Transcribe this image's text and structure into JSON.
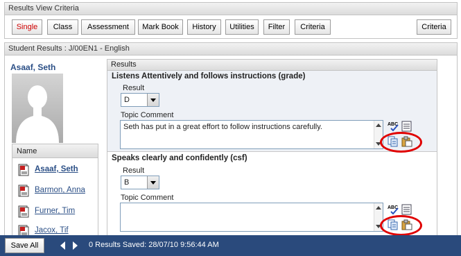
{
  "criteria_panel": {
    "title": "Results View Criteria",
    "buttons": [
      {
        "label": "Single",
        "active": true
      },
      {
        "label": "Class",
        "active": false
      },
      {
        "label": "Assessment",
        "active": false
      },
      {
        "label": "Mark Book",
        "active": false
      },
      {
        "label": "History",
        "active": false
      },
      {
        "label": "Utilities",
        "active": false
      },
      {
        "label": "Filter",
        "active": false
      },
      {
        "label": "Criteria",
        "active": false
      }
    ],
    "right_button_label": "Criteria"
  },
  "student_panel": {
    "title": "Student Results : J/00EN1 - English",
    "student_name": "Asaaf, Seth",
    "list_header": "Name",
    "students": [
      {
        "name": "Asaaf, Seth",
        "current": true
      },
      {
        "name": "Barmon, Anna",
        "current": false
      },
      {
        "name": "Furner, Tim",
        "current": false
      },
      {
        "name": "Jacox, Tif",
        "current": false
      }
    ]
  },
  "results": {
    "header": "Results",
    "topics": [
      {
        "title": "Listens Attentively and follows instructions  (grade)",
        "result_label": "Result",
        "result_value": "D",
        "comment_label": "Topic Comment",
        "comment": "Seth has put in a great effort to follow instructions carefully."
      },
      {
        "title": "Speaks clearly and confidently  (csf)",
        "result_label": "Result",
        "result_value": "B",
        "comment_label": "Topic Comment",
        "comment": ""
      }
    ],
    "spell_check_text": "ABC"
  },
  "footer": {
    "save_label": "Save All",
    "status": "0 Results Saved: 28/07/10 9:56:44 AM"
  },
  "colors": {
    "footer_bg": "#2a4a7c",
    "link": "#2b4f86",
    "active_button_text": "#d00000",
    "highlight_ring": "#e00000"
  }
}
